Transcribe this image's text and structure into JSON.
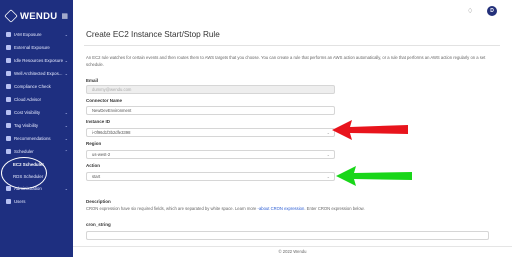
{
  "brand": {
    "name": "WENDU",
    "grid_icon": "▦"
  },
  "sidebar": {
    "items": [
      {
        "label": "IAM Exposure",
        "icon": "lock-icon",
        "chevron": "⌄"
      },
      {
        "label": "External Exposure",
        "icon": "globe-icon",
        "chevron": ""
      },
      {
        "label": "Idle Resources Exposure",
        "icon": "clock-icon",
        "chevron": "⌄"
      },
      {
        "label": "Well Architected Expos...",
        "icon": "building-icon",
        "chevron": "⌄"
      },
      {
        "label": "Compliance Check",
        "icon": "check-icon",
        "chevron": ""
      },
      {
        "label": "Cloud Advisor",
        "icon": "cloud-icon",
        "chevron": ""
      },
      {
        "label": "Cost Visibility",
        "icon": "dollar-icon",
        "chevron": "⌄"
      },
      {
        "label": "Tag Visibility",
        "icon": "tag-icon",
        "chevron": "⌄"
      },
      {
        "label": "Recommendations",
        "icon": "lightbulb-icon",
        "chevron": "⌄"
      },
      {
        "label": "Scheduler",
        "icon": "calendar-icon",
        "chevron": "⌃"
      }
    ],
    "sub_items": [
      {
        "label": "EC2 Scheduler",
        "active": true
      },
      {
        "label": "RDS Scheduler",
        "active": false
      }
    ],
    "bottom_items": [
      {
        "label": "Administration",
        "icon": "settings-icon",
        "chevron": "⌄"
      },
      {
        "label": "Users",
        "icon": "users-icon",
        "chevron": ""
      }
    ]
  },
  "topbar": {
    "bell_icon": "♢",
    "avatar_letter": "D"
  },
  "page": {
    "title": "Create EC2 Instance Start/Stop Rule",
    "intro": "An EC2 rule watches for certain events and then routes them to AWS targets that you choose. You can create a rule that performs an AWS action automatically, or a rule that performs an AWS action regularly on a set schedule.",
    "email_label": "Email",
    "email_value": "dummy@wendu.com",
    "connector_label": "Connector Name",
    "connector_value": "NewDevEnvironment",
    "instance_label": "Instance ID",
    "instance_value": "i-0f96d1f3b2dfe3398",
    "region_label": "Region",
    "region_value": "us-west-2",
    "action_label": "Action",
    "action_value": "start",
    "description_label": "Description",
    "description_text_1": "CRON expression have six required fields, which are separated by white space. Learn more ",
    "description_link": "-about CRON expression",
    "description_text_2": ". Enter CRON expression below.",
    "cron_label": "cron_string",
    "dropdown_glyph": "⌄"
  },
  "footer": {
    "text": "© 2022 Wendu"
  },
  "colors": {
    "sidebar": "#1e2f80",
    "red_arrow": "#e8141c",
    "green_arrow": "#19d619",
    "link": "#2a5cd4"
  }
}
